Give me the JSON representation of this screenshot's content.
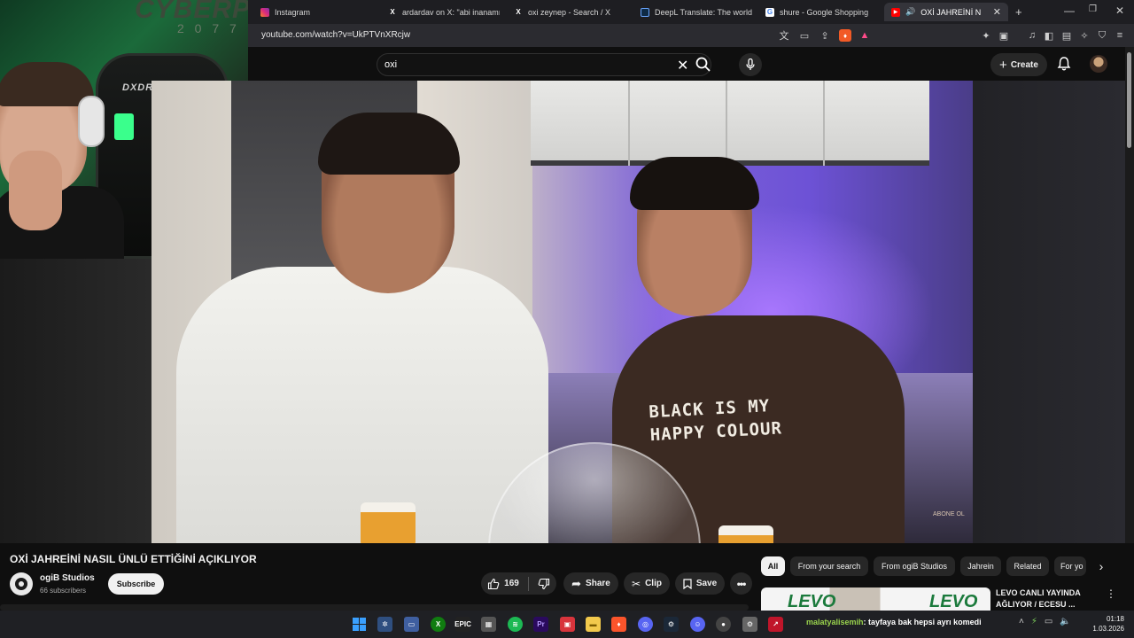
{
  "browser": {
    "tabs": [
      {
        "label": "Instagram",
        "icon": "instagram-icon",
        "color": "#e1306c"
      },
      {
        "label": "ardardav on X: \"abi inanamıyor",
        "icon": "x-icon",
        "color": "#ffffff"
      },
      {
        "label": "oxi zeynep - Search / X",
        "icon": "x-icon",
        "color": "#ffffff"
      },
      {
        "label": "DeepL Translate: The world's m",
        "icon": "deepl-icon",
        "color": "#0f2b46"
      },
      {
        "label": "shure - Google Shopping",
        "icon": "google-shopping-icon",
        "color": "#4285f4"
      },
      {
        "label": "OXİ JAHREİNİ NASIL Ü",
        "icon": "youtube-icon",
        "color": "#ff0000"
      }
    ],
    "new_tab": "+",
    "url": "youtube.com/watch?v=UkPTVnXRcjw"
  },
  "youtube": {
    "search_query": "oxi",
    "create_label": "Create"
  },
  "video": {
    "shirt_line1": "BLACK IS MY",
    "shirt_line2": "HAPPY COLOUR",
    "watermark": "ABONE OL",
    "title": "OXİ JAHREİNİ NASIL ÜNLÜ ETTİĞİNİ AÇIKLIYOR",
    "channel_name": "ogiB Studios",
    "subscribers": "66 subscribers",
    "subscribe_label": "Subscribe",
    "like_count": "169",
    "share_label": "Share",
    "clip_label": "Clip",
    "save_label": "Save"
  },
  "webcam": {
    "chair_brand": "DXDRIVE",
    "neon_text": "CYBERPU",
    "neon_sub": "2 0 7 7"
  },
  "sidebar": {
    "chips": [
      "All",
      "From your search",
      "From ogiB Studios",
      "Jahrein",
      "Related",
      "For yo"
    ],
    "recommendation_title": "LEVO CANLI YAYINDA AĞLIYOR / ECESU ...",
    "thumb_text": "LEVO"
  },
  "taskbar": {
    "chat_user": "malatyalisemih",
    "chat_message": ": tayfaya bak hepsi ayrı komedi",
    "time": "01:18",
    "date": "1.03.2026"
  },
  "colors": {
    "accent_red": "#ff0000",
    "bg": "#0f0f0f",
    "chip_bg": "#272727"
  }
}
